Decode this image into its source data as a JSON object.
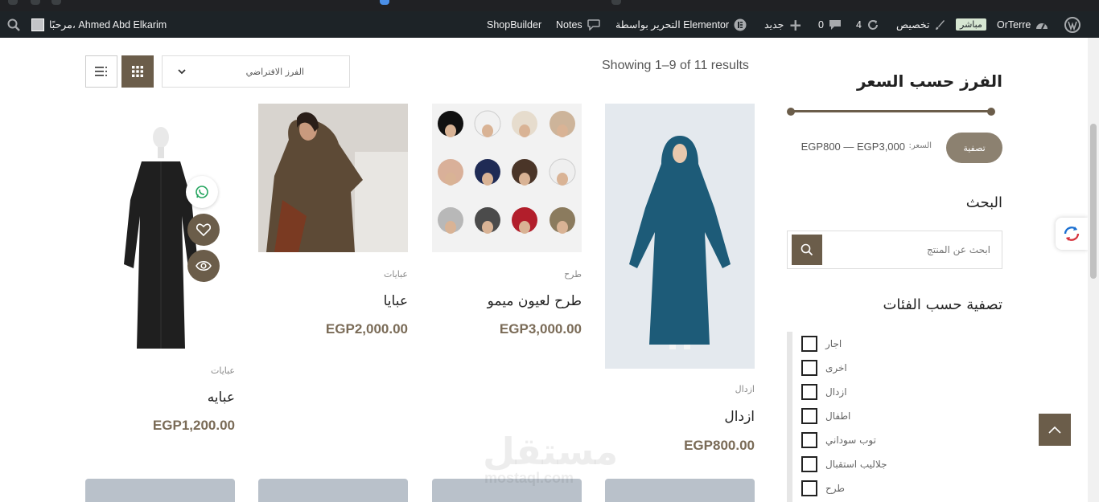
{
  "adminbar": {
    "wp_logo": "wordpress-icon",
    "site_name": "OrTerre",
    "live_badge": "مباشر",
    "customize": "تخصيص",
    "updates_count": "4",
    "comments_count": "0",
    "new_label": "جديد",
    "elementor_label": "التحرير بواسطة Elementor",
    "notes_label": "Notes",
    "shopbuilder_label": "ShopBuilder",
    "greeting": "مرحبًا، Ahmed Abd Elkarim"
  },
  "sidebar": {
    "price_title": "الفرز حسب السعر",
    "filter_button": "تصفية",
    "price_prefix": "السعر:",
    "price_range": "EGP800 — EGP3,000",
    "search_title": "البحث",
    "search_placeholder": "ابحث عن المنتج",
    "categories_title": "تصفية حسب الفئات",
    "categories": [
      "اجار",
      "اخرى",
      "ازدال",
      "اطفال",
      "توب سوداني",
      "جلاليب استقبال",
      "طرح"
    ]
  },
  "toolbar": {
    "results_text": "Showing 1–9 of 11 results",
    "sort_selected": "الفرز الافتراضي"
  },
  "products": [
    {
      "category": "ازدال",
      "name": "ازدال",
      "price": "EGP800.00"
    },
    {
      "category": "طرح",
      "name": "طرح لعيون ميمو",
      "price": "EGP3,000.00"
    },
    {
      "category": "عبايات",
      "name": "عبايا",
      "price": "EGP2,000.00"
    },
    {
      "category": "عبايات",
      "name": "عبايه",
      "price": "EGP1,200.00"
    }
  ],
  "colors": {
    "accent": "#6b5d4a",
    "price": "#7a6b57",
    "adminbar": "#1d2327"
  },
  "watermark": {
    "arabic": "مستقل",
    "latin": "mostaql.com"
  }
}
